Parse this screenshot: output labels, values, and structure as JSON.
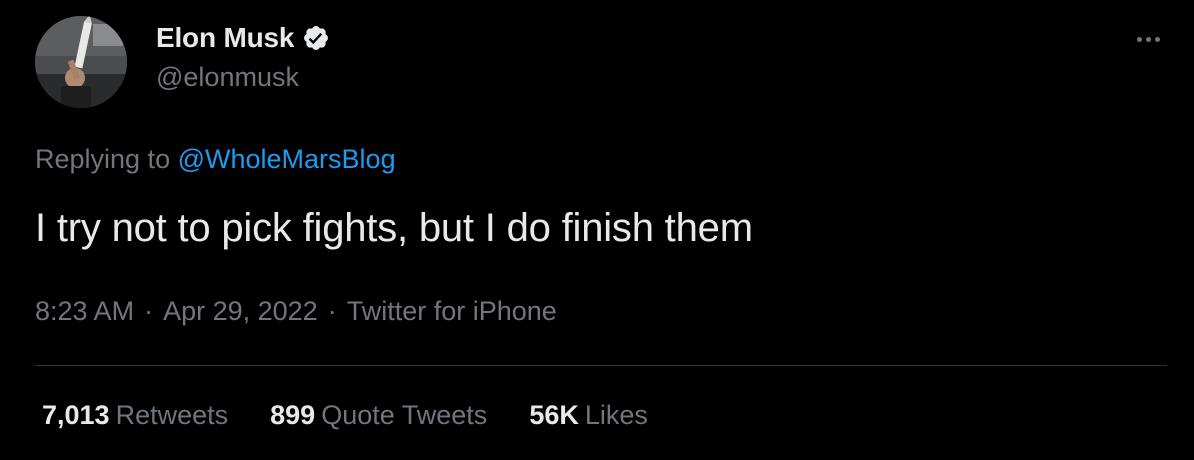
{
  "author": {
    "display_name": "Elon Musk",
    "handle": "@elonmusk",
    "verified": true,
    "avatar_icon": "profile-photo",
    "verified_icon": "verified-badge-icon"
  },
  "more_icon": "more-horizontal-icon",
  "reply": {
    "prefix": "Replying to",
    "mention": "@WholeMarsBlog"
  },
  "tweet": {
    "text": "I try not to pick fights, but I do finish them"
  },
  "meta": {
    "time": "8:23 AM",
    "separator": "·",
    "date": "Apr 29, 2022",
    "source": "Twitter for iPhone"
  },
  "stats": [
    {
      "value": "7,013",
      "label": "Retweets"
    },
    {
      "value": "899",
      "label": "Quote Tweets"
    },
    {
      "value": "56K",
      "label": "Likes"
    }
  ],
  "colors": {
    "background": "#000000",
    "primary_text": "#e7e9ea",
    "secondary_text": "#71767b",
    "link": "#1d9bf0",
    "divider": "#2f3336"
  }
}
